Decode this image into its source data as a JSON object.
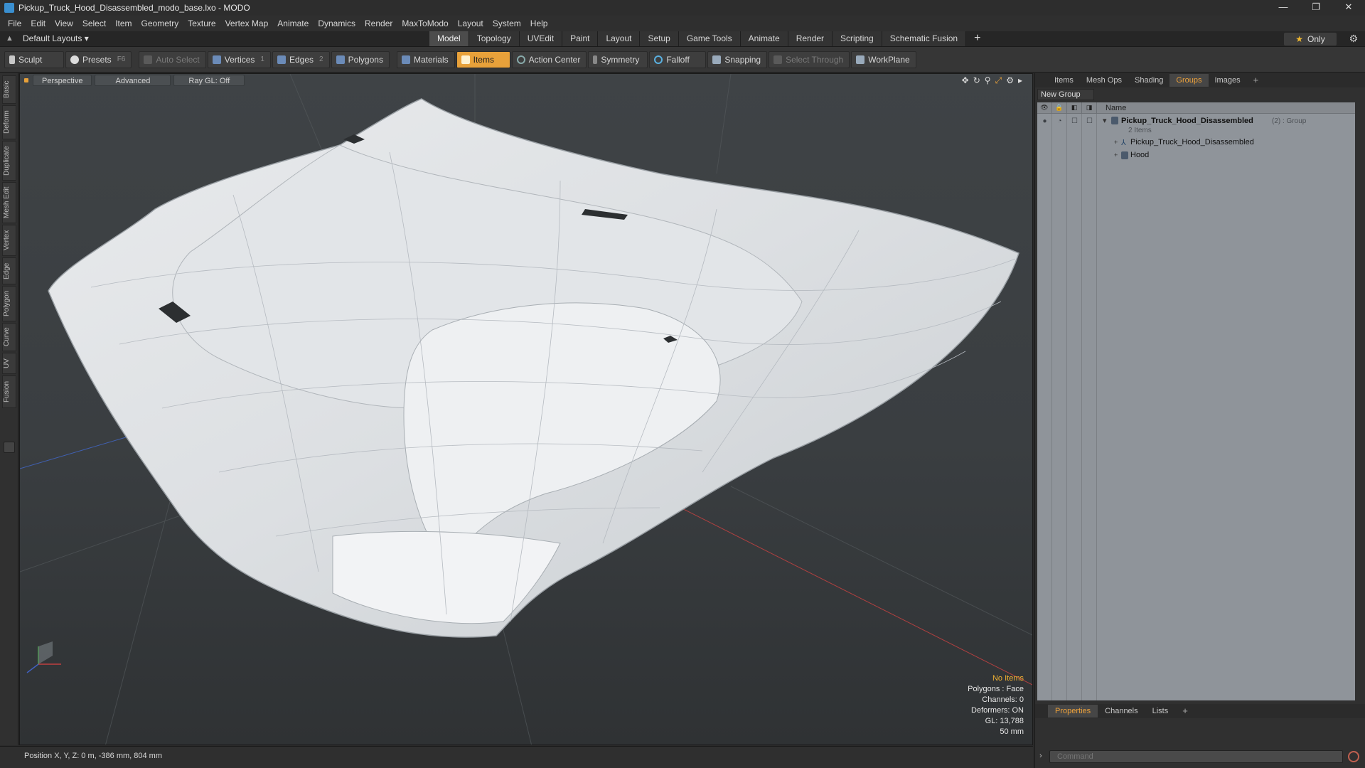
{
  "window": {
    "title": "Pickup_Truck_Hood_Disassembled_modo_base.lxo - MODO",
    "min": "—",
    "max": "❐",
    "close": "✕"
  },
  "menu": [
    "File",
    "Edit",
    "View",
    "Select",
    "Item",
    "Geometry",
    "Texture",
    "Vertex Map",
    "Animate",
    "Dynamics",
    "Render",
    "MaxToModo",
    "Layout",
    "System",
    "Help"
  ],
  "layoutbar": {
    "layouts_label": "Default Layouts ▾",
    "tabs": [
      "Model",
      "Topology",
      "UVEdit",
      "Paint",
      "Layout",
      "Setup",
      "Game Tools",
      "Animate",
      "Render",
      "Scripting",
      "Schematic Fusion"
    ],
    "active_tab": "Model",
    "plus": "+",
    "only_label": "Only",
    "only_star": "★",
    "gear": "⚙"
  },
  "toolbar": {
    "sculpt": "Sculpt",
    "presets": "Presets",
    "presets_key": "F6",
    "auto_select": "Auto Select",
    "vertices": "Vertices",
    "vertices_count": "1",
    "edges": "Edges",
    "edges_count": "2",
    "polygons": "Polygons",
    "materials": "Materials",
    "items": "Items",
    "action_center": "Action Center",
    "symmetry": "Symmetry",
    "falloff": "Falloff",
    "snapping": "Snapping",
    "select_through": "Select Through",
    "workplane": "WorkPlane"
  },
  "left_tabs": [
    "Basic",
    "Deform",
    "Duplicate",
    "Mesh Edit",
    "Vertex",
    "Edge",
    "Polygon",
    "Curve",
    "UV",
    "Fusion"
  ],
  "viewport": {
    "view": "Perspective",
    "shading": "Advanced",
    "raygl": "Ray GL: Off",
    "info": {
      "selection": "No Items",
      "polygons": "Polygons : Face",
      "channels": "Channels: 0",
      "deformers": "Deformers: ON",
      "gl": "GL: 13,788",
      "scale": "50 mm"
    },
    "colors": {
      "mesh": "#e4e6e8",
      "grid": "#55595c",
      "x_axis": "#b04040",
      "z_axis": "#4060b0"
    }
  },
  "status": {
    "position": "Position X, Y, Z:  0 m, -386 mm, 804 mm"
  },
  "right_panel": {
    "tabs": [
      "Items",
      "Mesh Ops",
      "Shading",
      "Groups",
      "Images"
    ],
    "active_tab": "Groups",
    "plus": "+",
    "new_group": "New Group",
    "column_name": "Name",
    "group": {
      "name": "Pickup_Truck_Hood_Disassembled",
      "suffix": "(2) : Group",
      "count_label": "2 Items",
      "children": [
        "Pickup_Truck_Hood_Disassembled",
        "Hood"
      ]
    },
    "props_tabs": [
      "Properties",
      "Channels",
      "Lists"
    ],
    "props_active": "Properties",
    "command_placeholder": "Command"
  }
}
